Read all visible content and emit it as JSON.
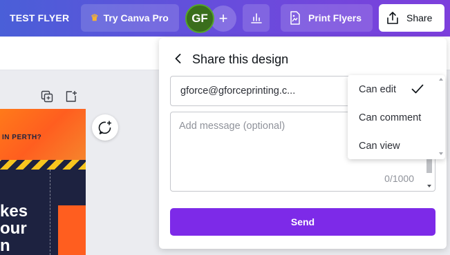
{
  "topbar": {
    "doc_title": "TEST FLYER",
    "try_pro_label": "Try Canva Pro",
    "avatar_initials": "GF",
    "add_label": "+",
    "print_label": "Print Flyers",
    "share_label": "Share"
  },
  "canvas": {
    "flyer_top_text": "IN PERTH?",
    "flyer_line1": "kes",
    "flyer_line2": "our",
    "flyer_line3": "n"
  },
  "share_panel": {
    "title": "Share this design",
    "email_value": "gforce@gforceprinting.c...",
    "message_placeholder": "Add message (optional)",
    "char_count": "0/1000",
    "send_label": "Send"
  },
  "permission_dropdown": {
    "options": [
      "Can edit",
      "Can comment",
      "Can view"
    ],
    "selected": "Can edit"
  },
  "colors": {
    "brand_purple": "#7d2ae8",
    "avatar_green": "#3a6e1c",
    "flyer_orange": "#ff5e1f",
    "flyer_navy": "#1d2240"
  },
  "icons": [
    "crown-icon",
    "bar-chart-icon",
    "print-flyer-icon",
    "share-upload-icon",
    "back-chevron-icon",
    "checkmark-icon",
    "add-comment-icon",
    "duplicate-page-icon",
    "add-page-icon"
  ]
}
